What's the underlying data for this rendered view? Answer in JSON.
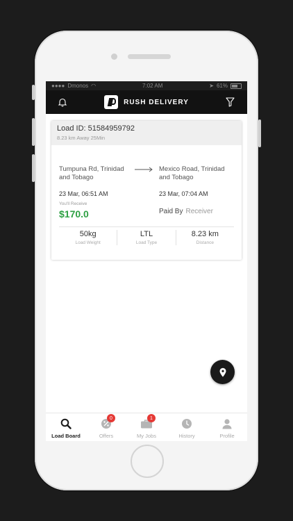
{
  "status_bar": {
    "carrier": "Dmonos",
    "time": "7:02 AM",
    "battery": "61%"
  },
  "app": {
    "brand_name": "RUSH DELIVERY"
  },
  "load_card": {
    "load_id_label": "Load ID: 51584959792",
    "subtitle": "8.23 km Away 25Min",
    "origin": "Tumpuna Rd, Trinidad and Tobago",
    "destination": "Mexico Road, Trinidad and Tobago",
    "pickup_time": "23 Mar, 06:51 AM",
    "dropoff_time": "23 Mar, 07:04 AM",
    "receive_label": "You'll Receive",
    "receive_amount": "$170.0",
    "paid_by_label": "Paid By",
    "paid_by_value": "Receiver",
    "stats": [
      {
        "value": "50kg",
        "label": "Load Weight"
      },
      {
        "value": "LTL",
        "label": "Load Type"
      },
      {
        "value": "8.23 km",
        "label": "Distance"
      }
    ]
  },
  "tabs": [
    {
      "label": "Load Board",
      "icon": "search-icon",
      "active": true
    },
    {
      "label": "Offers",
      "icon": "percent-icon",
      "badge": "0"
    },
    {
      "label": "My Jobs",
      "icon": "briefcase-icon",
      "badge": "1"
    },
    {
      "label": "History",
      "icon": "clock-icon"
    },
    {
      "label": "Profile",
      "icon": "user-icon"
    }
  ],
  "colors": {
    "accent_green": "#2ea043",
    "badge_red": "#e53935",
    "appbar": "#121212"
  }
}
